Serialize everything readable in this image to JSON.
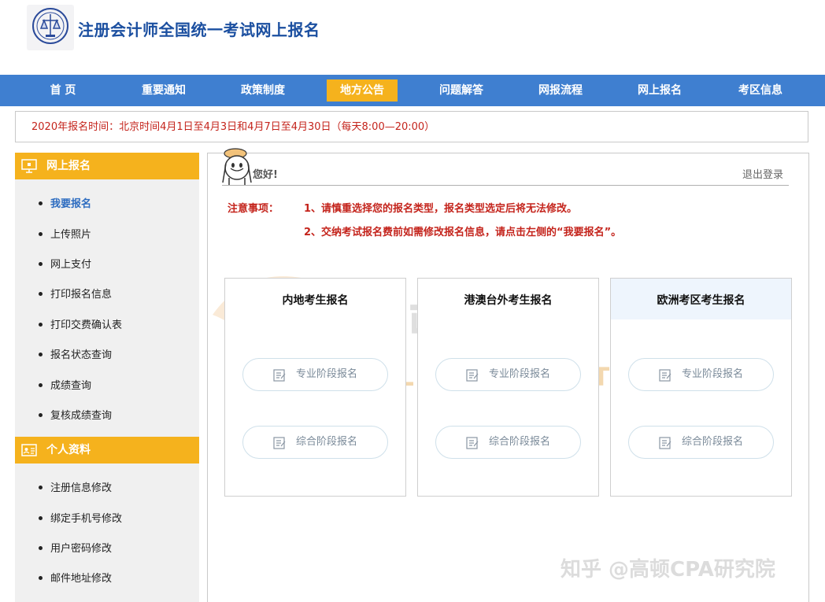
{
  "site": {
    "title": "注册会计师全国统一考试网上报名"
  },
  "nav": [
    {
      "label": "首 页"
    },
    {
      "label": "重要通知"
    },
    {
      "label": "政策制度"
    },
    {
      "label": "地方公告"
    },
    {
      "label": "问题解答"
    },
    {
      "label": "网报流程"
    },
    {
      "label": "网上报名"
    },
    {
      "label": "考区信息"
    }
  ],
  "nav_active_index": 3,
  "notice": "2020年报名时间：北京时间4月1日至4月3日和4月7日至4月30日（每天8:00—20:00）",
  "sidebar": {
    "sections": [
      {
        "title": "网上报名",
        "icon": "monitor-icon",
        "items": [
          "我要报名",
          "上传照片",
          "网上支付",
          "打印报名信息",
          "打印交费确认表",
          "报名状态查询",
          "成绩查询",
          "复核成绩查询"
        ]
      },
      {
        "title": "个人资料",
        "icon": "id-card-icon",
        "items": [
          "注册信息修改",
          "绑定手机号修改",
          "用户密码修改",
          "邮件地址修改"
        ]
      }
    ],
    "current_item": "我要报名"
  },
  "main": {
    "greeting": "您好!",
    "logout": "退出登录",
    "notes_label": "注意事项：",
    "notes": [
      "1、请慎重选择您的报名类型，报名类型选定后将无法修改。",
      "2、交纳考试报名费前如需修改报名信息，请点击左侧的“我要报名”。"
    ],
    "columns": [
      {
        "title": "内地考生报名",
        "buttons": [
          "专业阶段报名",
          "综合阶段报名"
        ]
      },
      {
        "title": "港澳台外考生报名",
        "buttons": [
          "专业阶段报名",
          "综合阶段报名"
        ]
      },
      {
        "title": "欧洲考区考生报名",
        "buttons": [
          "专业阶段报名",
          "综合阶段报名"
        ]
      }
    ]
  },
  "watermark": {
    "cn": "高顿教育",
    "en": "GOLDEN EDUCATION"
  },
  "zhihu_watermark": "知乎 @高顿CPA研究院",
  "colors": {
    "nav_bg": "#3f7fd0",
    "accent": "#f5b21d",
    "notice_red": "#c4241c",
    "title_blue": "#1b4fa0"
  }
}
